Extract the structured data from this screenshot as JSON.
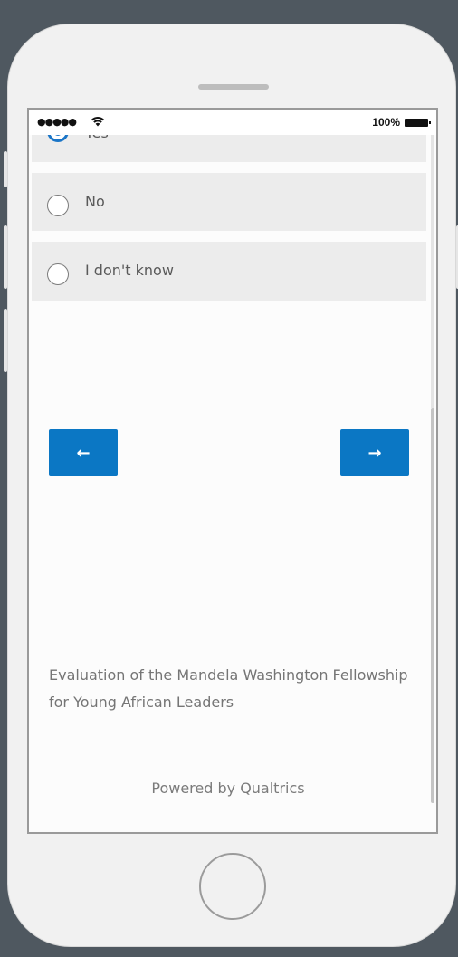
{
  "status_bar": {
    "signal": "●●●●●",
    "battery_percent": "100%"
  },
  "options": [
    {
      "label": "Yes",
      "selected": true
    },
    {
      "label": "No",
      "selected": false
    },
    {
      "label": "I don't know",
      "selected": false
    }
  ],
  "navigation": {
    "back_label": "←",
    "next_label": "→"
  },
  "footer": {
    "survey_title": "Evaluation of the Mandela Washington Fellowship for Young African Leaders",
    "powered_by": "Powered by Qualtrics"
  },
  "colors": {
    "accent": "#0b77c4",
    "option_bg": "#ececec",
    "device_bg": "#4f5860"
  }
}
